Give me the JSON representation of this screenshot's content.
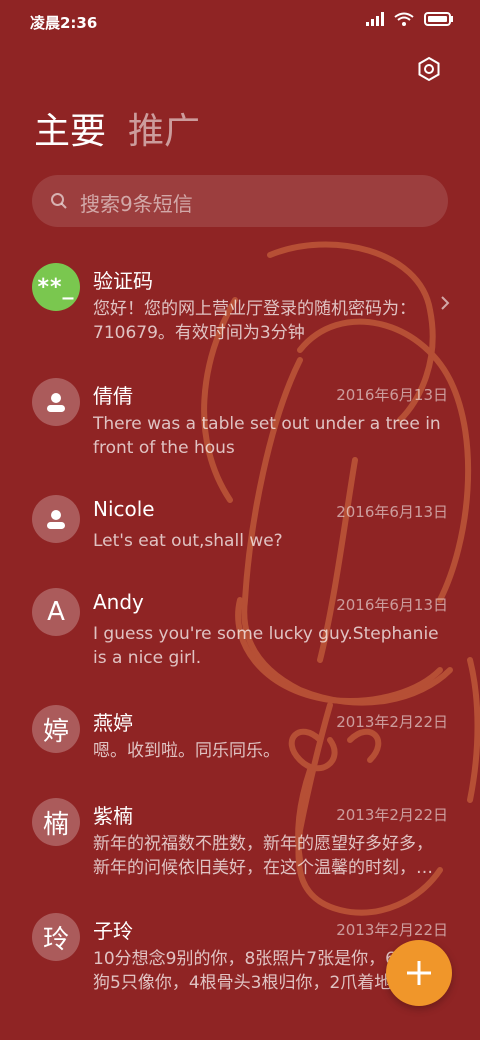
{
  "status_bar": {
    "time": "凌晨2:36"
  },
  "tabs": [
    {
      "label": "主要"
    },
    {
      "label": "推广"
    }
  ],
  "search": {
    "placeholder": "搜索9条短信"
  },
  "messages": [
    {
      "name": "验证码",
      "avatar": "**_",
      "date": "",
      "preview": "您好！您的网上营业厅登录的随机密码为：710679。有效时间为3分钟"
    },
    {
      "name": "倩倩",
      "avatar": "",
      "date": "2016年6月13日",
      "preview": "There was a table set out under a tree in front of the hous"
    },
    {
      "name": "Nicole",
      "avatar": "",
      "date": "2016年6月13日",
      "preview": "Let's eat out,shall we?"
    },
    {
      "name": "Andy",
      "avatar": "A",
      "date": "2016年6月13日",
      "preview": "I guess you're some lucky guy.Stephanie is a nice girl."
    },
    {
      "name": "燕婷",
      "avatar": "婷",
      "date": "2013年2月22日",
      "preview": "嗯。收到啦。同乐同乐。"
    },
    {
      "name": "紫楠",
      "avatar": "楠",
      "date": "2013年2月22日",
      "preview": "新年的祝福数不胜数，新年的愿望好多好多，新年的问候依旧美好，在这个温馨的时刻，…"
    },
    {
      "name": "子玲",
      "avatar": "玲",
      "date": "2013年2月22日",
      "preview": "10分想念9别的你，8张照片7张是你，6只小狗5只像你，4根骨头3根归你，2爪着地"
    }
  ],
  "colors": {
    "background": "#8f2424",
    "fab": "#f0962a",
    "verify_avatar": "#7ac74f"
  },
  "icons": [
    "signal-icon",
    "wifi-icon",
    "battery-icon",
    "settings-icon",
    "search-icon",
    "person-icon",
    "chevron-right-icon",
    "plus-icon"
  ]
}
